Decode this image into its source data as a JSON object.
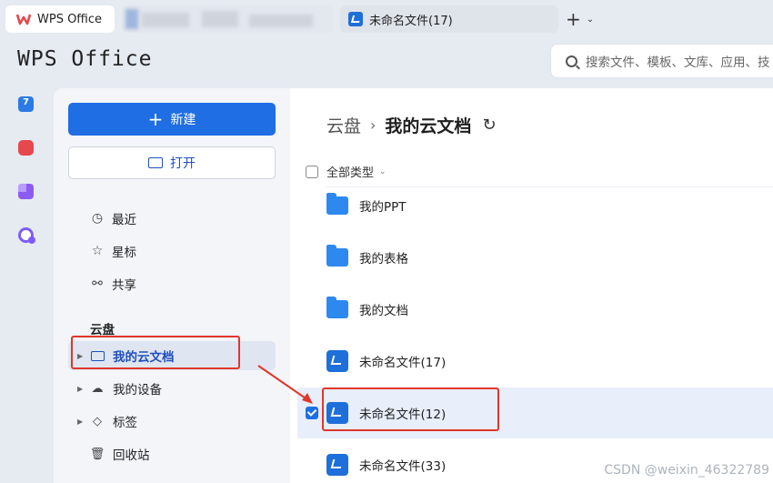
{
  "tabs": {
    "home_label": "WPS Office",
    "doc_label": "未命名文件(17)",
    "new_tab_label": "+",
    "new_tab_menu": "⌄"
  },
  "header": {
    "brand": "WPS Office",
    "search_placeholder": "搜索文件、模板、文库、应用、技"
  },
  "sidebar": {
    "new_label": "新建",
    "open_label": "打开",
    "nav": [
      {
        "label": "最近",
        "icon": "clock-icon"
      },
      {
        "label": "星标",
        "icon": "star-icon"
      },
      {
        "label": "共享",
        "icon": "share-icon"
      }
    ],
    "cloud_section": "云盘",
    "tree": [
      {
        "label": "我的云文档",
        "icon": "folder-icon",
        "active": true
      },
      {
        "label": "我的设备",
        "icon": "cloud-device-icon"
      },
      {
        "label": "标签",
        "icon": "tag-icon"
      },
      {
        "label": "回收站",
        "icon": "trash-icon"
      }
    ]
  },
  "main": {
    "breadcrumb_root": "云盘",
    "breadcrumb_current": "我的云文档",
    "filter_label": "全部类型",
    "files": [
      {
        "name": "我的PPT",
        "type": "folder"
      },
      {
        "name": "我的表格",
        "type": "folder"
      },
      {
        "name": "我的文档",
        "type": "folder"
      },
      {
        "name": "未命名文件(17)",
        "type": "doc"
      },
      {
        "name": "未命名文件(12)",
        "type": "doc",
        "selected": true
      },
      {
        "name": "未命名文件(33)",
        "type": "doc"
      }
    ]
  },
  "colors": {
    "accent": "#1f6ee3",
    "highlight": "#e0372b"
  },
  "watermark": "CSDN @weixin_46322789"
}
